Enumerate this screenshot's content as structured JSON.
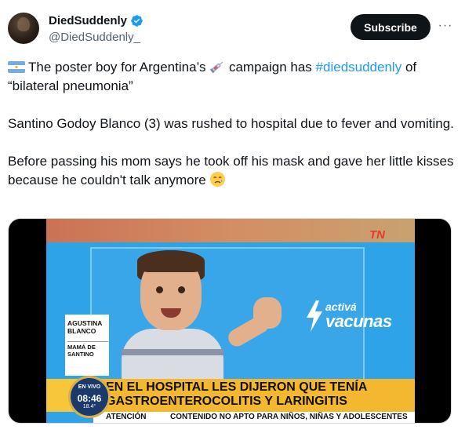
{
  "author": {
    "display_name": "DiedSuddenly",
    "handle": "@DiedSuddenly_",
    "verified": true,
    "avatar_icon": "avatar-image"
  },
  "actions": {
    "subscribe_label": "Subscribe",
    "more_label": "···"
  },
  "tweet": {
    "line1_pre": "The poster boy for Argentina’s",
    "line1_mid": "campaign has",
    "hashtag": "#diedsuddenly",
    "line1_post": "of",
    "line2": "“bilateral pneumonia”",
    "para2": "Santino Godoy Blanco (3) was rushed to hospital due to fever and vomiting.",
    "para3": "Before passing his mom says he took off his mask and gave her little kisses because he couldn't talk anymore"
  },
  "media": {
    "channel_logo": "TN",
    "campaign_small": "activá",
    "campaign_big": "vacunas",
    "lower_third_name": "AGUSTINA BLANCO",
    "lower_third_role": "MAMÁ DE SANTINO",
    "clock_live": "EN VIVO",
    "clock_time": "08:46",
    "clock_temp": "18.4°",
    "banner_text": "EN EL HOSPITAL LES DIJERON QUE TENÍA GASTROENTEROCOLITIS Y LARINGITIS",
    "warning_label": "ATENCIÓN",
    "warning_text": "CONTENIDO NO APTO PARA NIÑOS, NIÑAS Y ADOLESCENTES"
  },
  "colors": {
    "link": "#1d9bf0",
    "text": "#0f1419",
    "secondary": "#536471",
    "verified": "#1d9bf0"
  }
}
